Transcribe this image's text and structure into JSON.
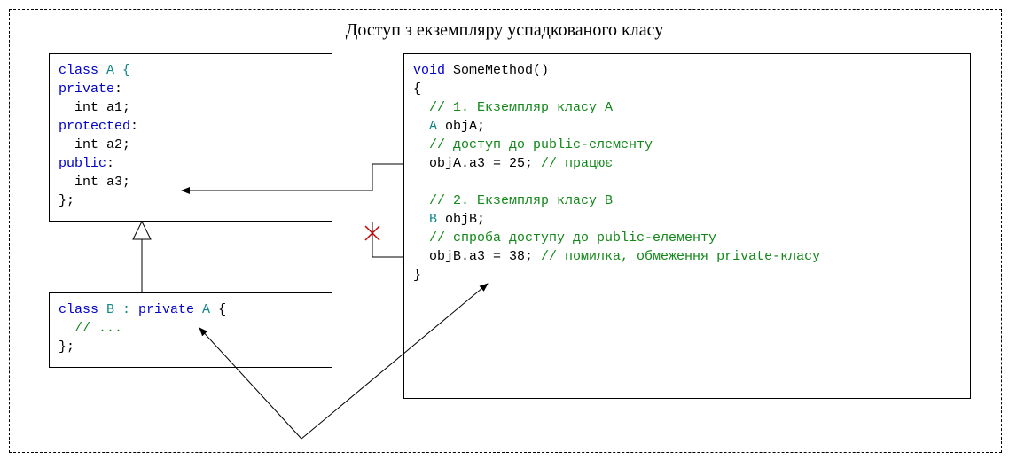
{
  "title": "Доступ з екземпляру успадкованого класу",
  "boxA": {
    "l1a": "class",
    "l1b": " A {",
    "l2a": "private",
    "l2b": ":",
    "l3": "  int a1;",
    "l4a": "protected",
    "l4b": ":",
    "l5": "  int a2;",
    "l6a": "public",
    "l6b": ":",
    "l7": "  int a3;",
    "l8": "};"
  },
  "boxB": {
    "l1a": "class",
    "l1b": " B : ",
    "l1c": "private",
    "l1d": " A ",
    "l1e": "{",
    "l2": "  // ...",
    "l3": "};"
  },
  "boxC": {
    "l1a": "void",
    "l1b": " SomeMethod()",
    "l2": "{",
    "l3": "  // 1. Екземпляр класу A",
    "l4a": "  A",
    "l4b": " objA;",
    "l5": "  // доступ до public-елементу",
    "l6a": "  objA.a3 = 25; ",
    "l6b": "// працює",
    "blank": " ",
    "l7": "  // 2. Екземпляр класу B",
    "l8a": "  B",
    "l8b": " objB;",
    "l9": "  // спроба доступу до public-елементу",
    "l10a": "  objB.a3 = 38; ",
    "l10b": "// помилка, обмеження private-класу",
    "l11": "}"
  }
}
